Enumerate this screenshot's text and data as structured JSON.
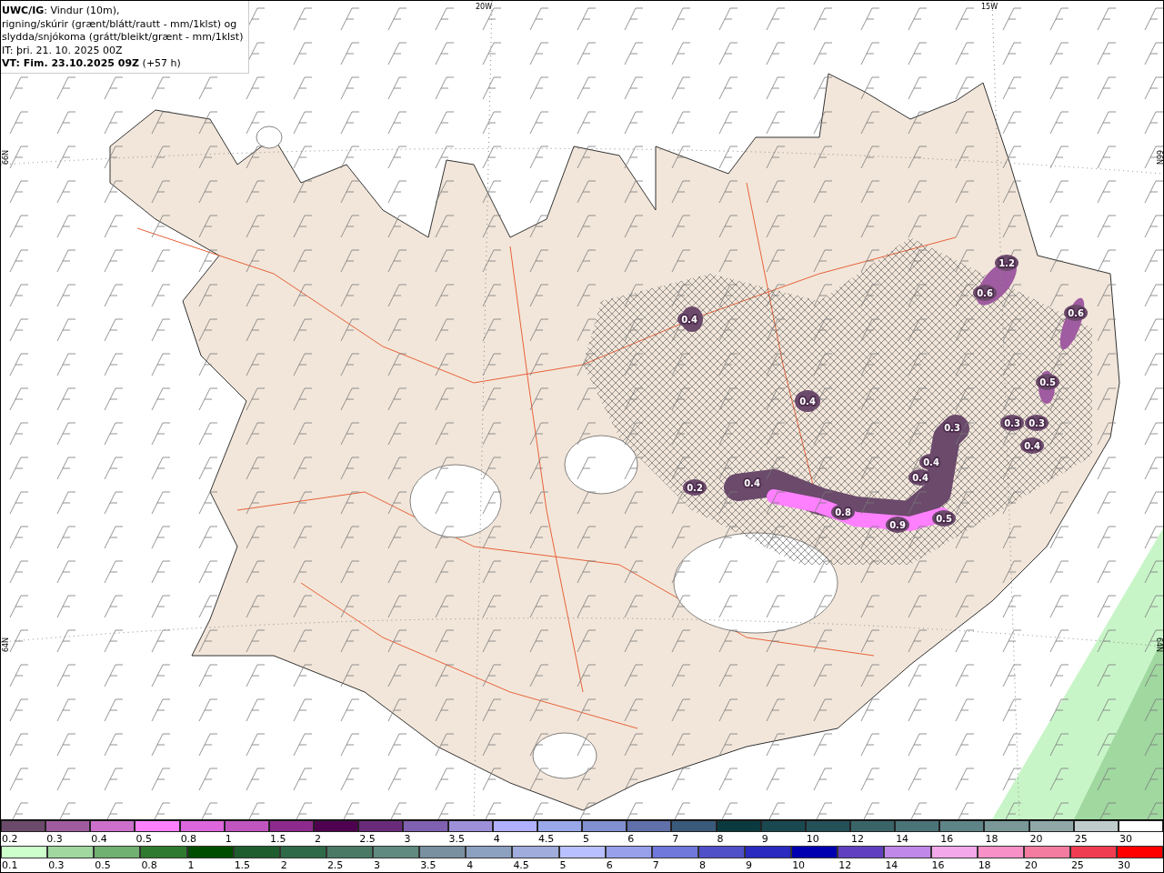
{
  "header": {
    "lines": [
      "**UWC/IG**: Vindur (10m),",
      "rigning/skúrir (grænt/blátt/rautt - mm/1klst) og",
      "slydda/snjókoma (grátt/bleikt/grænt - mm/1klst)",
      "IT: þri. 21. 10. 2025 00Z",
      "**VT: Fim. 23.10.2025 09Z** (+57 h)"
    ]
  },
  "map": {
    "longitude_labels": [
      "20W",
      "15W"
    ],
    "latitude_labels_left": [
      "66N",
      "64N"
    ],
    "latitude_labels_right": [
      "66N",
      "64N"
    ],
    "precip_values": [
      "1.2",
      "0.6",
      "0.6",
      "0.4",
      "0.5",
      "0.4",
      "0.3",
      "0.3",
      "0.3",
      "0.4",
      "0.4",
      "0.4",
      "0.4",
      "0.2",
      "0.8",
      "0.9",
      "0.5"
    ]
  },
  "legend": {
    "rows": [
      {
        "kind": "snow",
        "bins": [
          {
            "label": "0.2",
            "color": "#6b4a6b"
          },
          {
            "label": "0.3",
            "color": "#a05ca0"
          },
          {
            "label": "0.4",
            "color": "#cc70cc"
          },
          {
            "label": "0.5",
            "color": "#ff80ff"
          },
          {
            "label": "0.8",
            "color": "#dd66dd"
          },
          {
            "label": "1",
            "color": "#c055c0"
          },
          {
            "label": "1.5",
            "color": "#8e2a8e"
          },
          {
            "label": "2",
            "color": "#4f004f"
          },
          {
            "label": "2.5",
            "color": "#6a2a7a"
          },
          {
            "label": "3",
            "color": "#8060b0"
          },
          {
            "label": "3.5",
            "color": "#9e90d8"
          },
          {
            "label": "4",
            "color": "#b0b0ff"
          },
          {
            "label": "4.5",
            "color": "#98a8e8"
          },
          {
            "label": "5",
            "color": "#8090d0"
          },
          {
            "label": "6",
            "color": "#6070a8"
          },
          {
            "label": "7",
            "color": "#3a5a7a"
          },
          {
            "label": "8",
            "color": "#0a3a40"
          },
          {
            "label": "9",
            "color": "#1a4850"
          },
          {
            "label": "10",
            "color": "#245058"
          },
          {
            "label": "12",
            "color": "#3a6468"
          },
          {
            "label": "14",
            "color": "#4a7478"
          },
          {
            "label": "16",
            "color": "#5e8488"
          },
          {
            "label": "18",
            "color": "#7a9898"
          },
          {
            "label": "20",
            "color": "#90a8a8"
          },
          {
            "label": "25",
            "color": "#c0cccc"
          },
          {
            "label": "30",
            "color": "#ffffff"
          }
        ]
      },
      {
        "kind": "rain",
        "bins": [
          {
            "label": "0.1",
            "color": "#ccffcc"
          },
          {
            "label": "0.3",
            "color": "#a0d8a0"
          },
          {
            "label": "0.5",
            "color": "#70b070"
          },
          {
            "label": "0.8",
            "color": "#2e7a2e"
          },
          {
            "label": "1",
            "color": "#004d00"
          },
          {
            "label": "1.5",
            "color": "#1e5e2e"
          },
          {
            "label": "2",
            "color": "#2e6a48"
          },
          {
            "label": "2.5",
            "color": "#4a7a66"
          },
          {
            "label": "3",
            "color": "#608a80"
          },
          {
            "label": "3.5",
            "color": "#7890a0"
          },
          {
            "label": "4",
            "color": "#8ca0c0"
          },
          {
            "label": "4.5",
            "color": "#a0acdc"
          },
          {
            "label": "5",
            "color": "#b8c0ff"
          },
          {
            "label": "6",
            "color": "#98a0ec"
          },
          {
            "label": "7",
            "color": "#7078dc"
          },
          {
            "label": "8",
            "color": "#5050c8"
          },
          {
            "label": "9",
            "color": "#2a2ac0"
          },
          {
            "label": "10",
            "color": "#0000b0"
          },
          {
            "label": "12",
            "color": "#6040c0"
          },
          {
            "label": "14",
            "color": "#c088e8"
          },
          {
            "label": "16",
            "color": "#f4a8ec"
          },
          {
            "label": "18",
            "color": "#f890c8"
          },
          {
            "label": "20",
            "color": "#f47ca0"
          },
          {
            "label": "25",
            "color": "#f03c50"
          },
          {
            "label": "30",
            "color": "#ff0000"
          }
        ]
      }
    ]
  }
}
